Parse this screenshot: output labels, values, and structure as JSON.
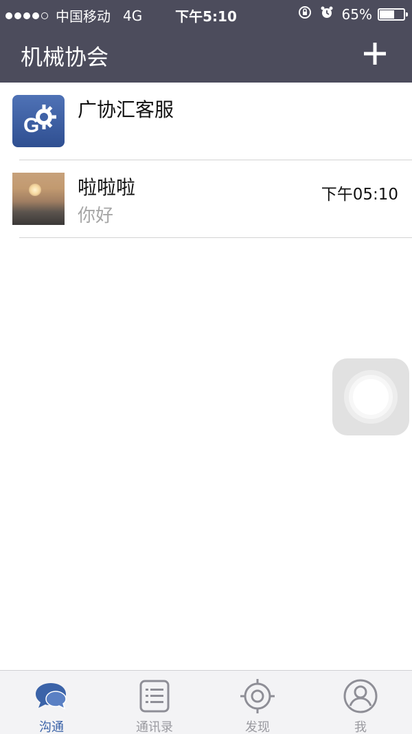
{
  "status_bar": {
    "carrier": "中国移动",
    "network": "4G",
    "time": "下午5:10",
    "battery_percent": "65%",
    "battery_level": 0.65
  },
  "nav": {
    "title": "机械协会",
    "add_icon": "plus-icon"
  },
  "conversations": [
    {
      "name": "广协汇客服",
      "message": "",
      "time": "",
      "avatar_letter": "G"
    },
    {
      "name": "啦啦啦",
      "message": "你好",
      "time": "下午05:10"
    }
  ],
  "tabs": [
    {
      "label": "沟通",
      "icon": "chat-bubbles-icon",
      "active": true
    },
    {
      "label": "通讯录",
      "icon": "contacts-list-icon",
      "active": false
    },
    {
      "label": "发现",
      "icon": "discover-target-icon",
      "active": false
    },
    {
      "label": "我",
      "icon": "profile-icon",
      "active": false
    }
  ],
  "colors": {
    "nav_background": "#4c4c5c",
    "active_tab": "#3b63a8",
    "inactive_tab": "#9a9aa0"
  }
}
